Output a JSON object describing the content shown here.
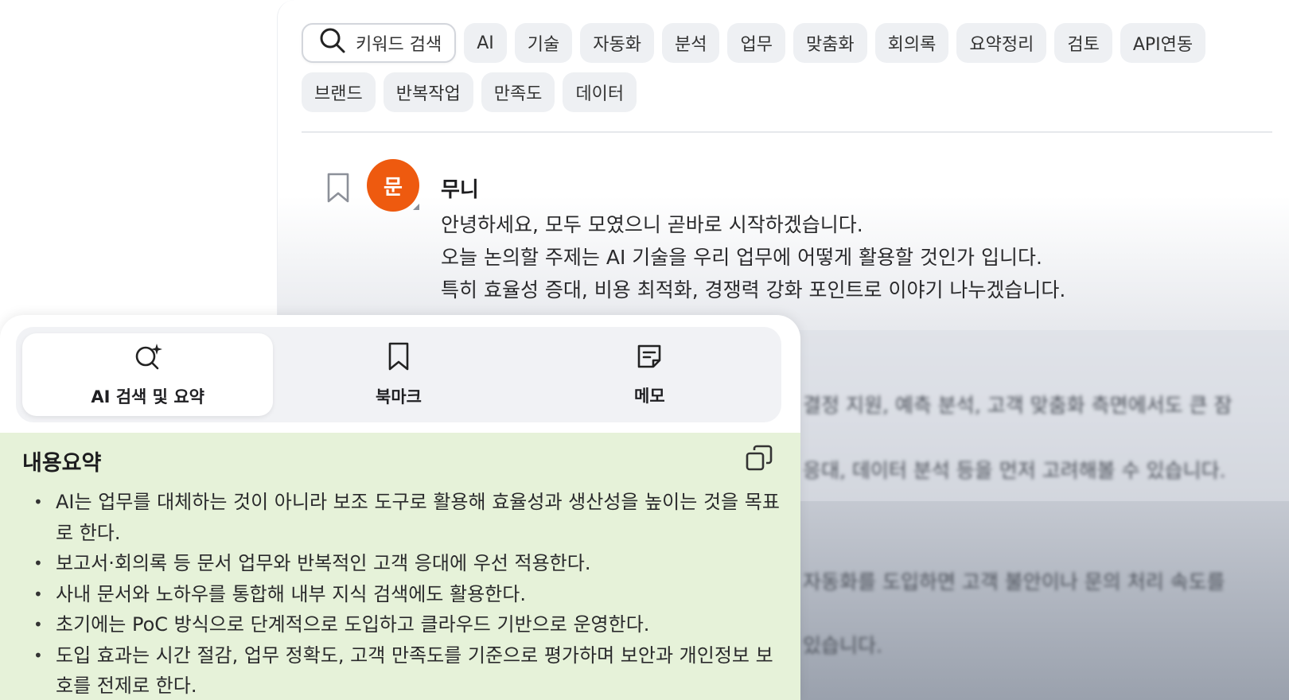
{
  "search": {
    "label": "키워드 검색"
  },
  "tags_row1": [
    "AI",
    "기술",
    "자동화",
    "분석",
    "업무",
    "맞춤화",
    "회의록",
    "요약정리",
    "검토",
    "API연동"
  ],
  "tags_row2": [
    "브랜드",
    "반복작업",
    "만족도",
    "데이터"
  ],
  "message": {
    "avatar_text": "문",
    "speaker": "무니",
    "lines": [
      "안녕하세요, 모두 모였으니 곧바로 시작하겠습니다.",
      "오늘 논의할 주제는 AI 기술을 우리 업무에 어떻게 활용할 것인가 입니다.",
      "특히 효율성 증대, 비용 최적화, 경쟁력 강화 포인트로 이야기 나누겠습니다."
    ]
  },
  "blurred_lines": [
    "결정 지원, 예측 분석, 고객 맞춤화 측면에서도 큰 잠",
    "응대, 데이터 분석 등을 먼저 고려해볼 수 있습니다.",
    "자동화를 도입하면 고객 불안이나 문의 처리 속도를",
    "있습니다."
  ],
  "tabs": [
    {
      "label": "AI 검색 및 요약",
      "icon": "ai-search-icon",
      "active": true
    },
    {
      "label": "북마크",
      "icon": "bookmark-icon",
      "active": false
    },
    {
      "label": "메모",
      "icon": "memo-icon",
      "active": false
    }
  ],
  "summary": {
    "title": "내용요약",
    "bullets": [
      "AI는 업무를 대체하는 것이 아니라 보조 도구로 활용해 효율성과 생산성을 높이는 것을 목표로 한다.",
      "보고서·회의록 등 문서 업무와 반복적인 고객 응대에 우선 적용한다.",
      "사내 문서와 노하우를 통합해 내부 지식 검색에도 활용한다.",
      "초기에는 PoC 방식으로 단계적으로 도입하고 클라우드 기반으로 운영한다.",
      "도입 효과는 시간 절감, 업무 정확도, 고객 만족도를 기준으로 평가하며 보안과 개인정보 보호를 전제로 한다."
    ]
  },
  "colors": {
    "avatar": "#ee5a0f",
    "summary_bg": "#e6f2d9"
  }
}
